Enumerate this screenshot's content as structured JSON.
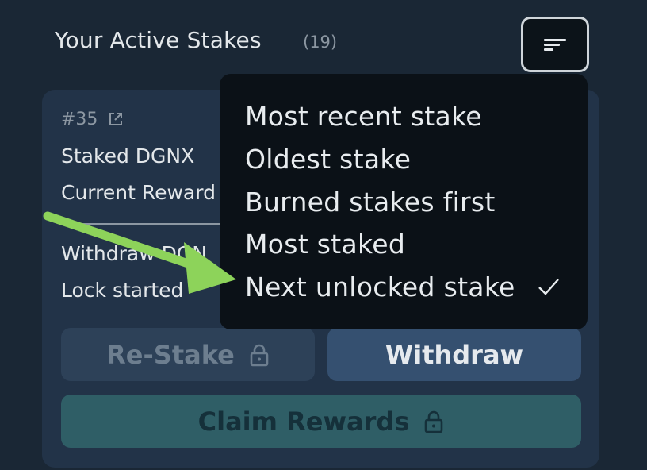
{
  "header": {
    "title": "Your Active Stakes",
    "count": "(19)"
  },
  "card": {
    "stake_id": "#35",
    "rows": {
      "staked": "Staked DGNX",
      "current_rewards": "Current Reward",
      "withdraw": "Withdraw DGN",
      "lock_started": "Lock started"
    },
    "buttons": {
      "restake": "Re-Stake",
      "withdraw": "Withdraw",
      "claim": "Claim Rewards"
    }
  },
  "sort_menu": {
    "items": [
      {
        "label": "Most recent stake",
        "selected": false
      },
      {
        "label": "Oldest stake",
        "selected": false
      },
      {
        "label": "Burned stakes first",
        "selected": false
      },
      {
        "label": "Most staked",
        "selected": false
      },
      {
        "label": "Next unlocked stake",
        "selected": true
      }
    ]
  },
  "icons": {
    "sort": "sort-icon",
    "external_link": "external-link-icon",
    "lock": "lock-icon",
    "check": "check-icon"
  },
  "colors": {
    "background": "#1a2735",
    "card": "#223348",
    "dropdown": "#0b1117",
    "withdraw_button": "#355070",
    "claim_button": "#2f5e66",
    "annotation_arrow": "#8dd35a"
  }
}
